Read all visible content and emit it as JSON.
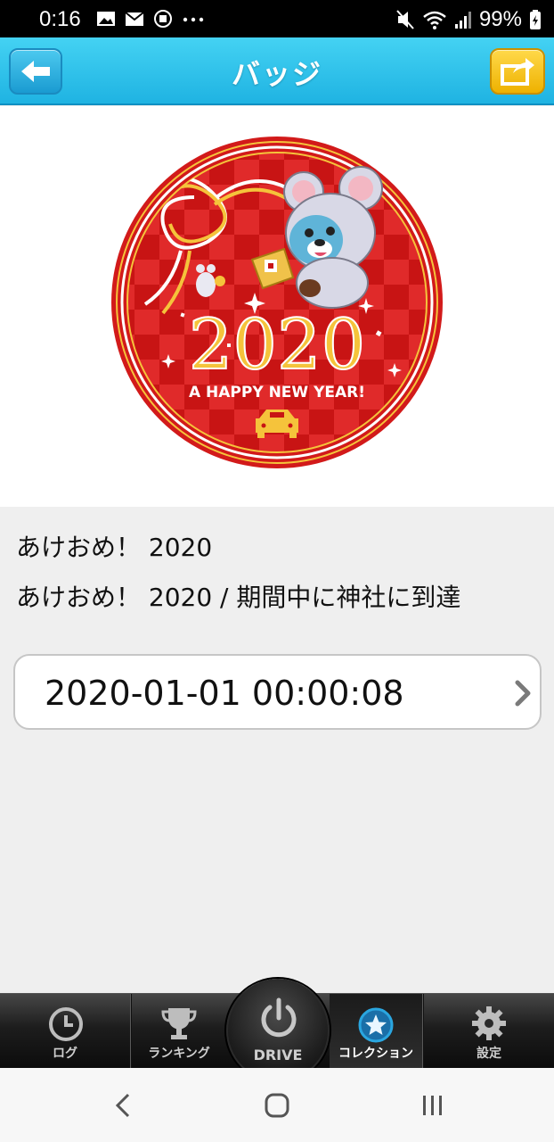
{
  "status_bar": {
    "time": "0:16",
    "battery": "99%"
  },
  "header": {
    "title": "バッジ"
  },
  "badge": {
    "year_text": "2020",
    "greeting": "A HAPPY NEW YEAR!",
    "name": "あけおめ！ 2020",
    "description": "あけおめ！ 2020 / 期間中に神社に到達",
    "date": "2020-01-01 00:00:08"
  },
  "tabs": [
    {
      "label": "ログ",
      "icon": "clock-icon"
    },
    {
      "label": "ランキング",
      "icon": "trophy-icon"
    },
    {
      "label": "DRIVE",
      "icon": "power-icon"
    },
    {
      "label": "コレクション",
      "icon": "star-icon",
      "active": true
    },
    {
      "label": "設定",
      "icon": "gear-icon"
    }
  ],
  "colors": {
    "header": "#1fb3e2",
    "share_button": "#f2b800",
    "badge_red": "#d21a1a",
    "badge_gold": "#f5c33b",
    "active_tab": "#2aa6e0"
  }
}
